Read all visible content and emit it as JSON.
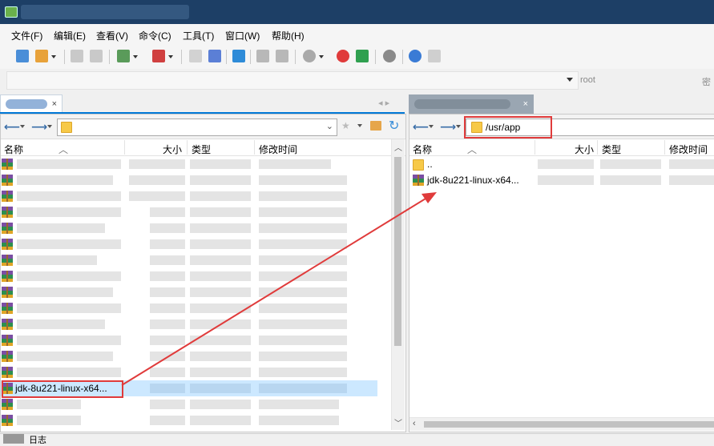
{
  "window": {
    "title": ""
  },
  "menu": [
    "文件(F)",
    "编辑(E)",
    "查看(V)",
    "命令(C)",
    "工具(T)",
    "窗口(W)",
    "帮助(H)"
  ],
  "session": {
    "host": "",
    "user": "root",
    "password_label": "密"
  },
  "tabs": {
    "left": "",
    "right": ""
  },
  "left_pane": {
    "path": "",
    "columns": {
      "name": "名称",
      "size": "大小",
      "type": "类型",
      "modified": "修改时间"
    },
    "highlighted_file": "jdk-8u221-linux-x64..."
  },
  "right_pane": {
    "path": "/usr/app",
    "columns": {
      "name": "名称",
      "size": "大小",
      "type": "类型",
      "modified": "修改时间"
    },
    "parent_dir": "..",
    "file": "jdk-8u221-linux-x64..."
  },
  "statusbar": {
    "label": "日志"
  },
  "colors": {
    "titlebar": "#1d3f66",
    "accent": "#0078d7",
    "annotation": "#e03b3b",
    "selection": "#cce8ff"
  }
}
